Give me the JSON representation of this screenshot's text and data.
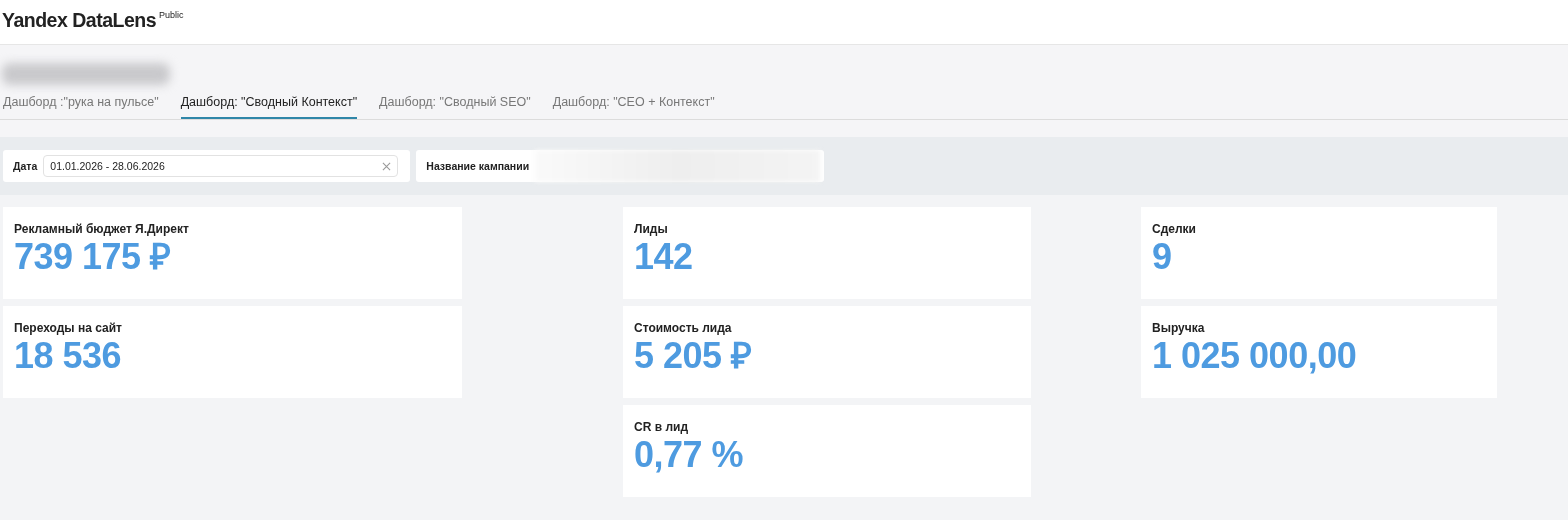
{
  "header": {
    "logo": "Yandex DataLens",
    "badge": "Public"
  },
  "tabs": [
    {
      "label": "Дашборд :\"рука на пульсе\"",
      "selected": false
    },
    {
      "label": "Дашборд: \"Сводный Контекст\"",
      "selected": true
    },
    {
      "label": "Дашборд: \"Сводный SEO\"",
      "selected": false
    },
    {
      "label": "Дашборд: \"CEO + Контекст\"",
      "selected": false
    }
  ],
  "filters": [
    {
      "kind": "date",
      "label": "Дата",
      "value": "01.01.2026 - 28.06.2026"
    },
    {
      "kind": "redacted",
      "label": "Название кампании"
    }
  ],
  "columns": [
    [
      {
        "label": "Рекламный бюджет Я.Директ",
        "value": "739 175 ₽"
      },
      {
        "label": "Переходы на сайт",
        "value": "18 536"
      }
    ],
    [
      {
        "label": "Лиды",
        "value": "142"
      },
      {
        "label": "Стоимость лида",
        "value": "5 205 ₽"
      },
      {
        "label": "CR в лид",
        "value": "0,77 %"
      }
    ],
    [
      {
        "label": "Сделки",
        "value": "9"
      },
      {
        "label": "Выручка",
        "value": "1 025 000,00"
      }
    ]
  ]
}
